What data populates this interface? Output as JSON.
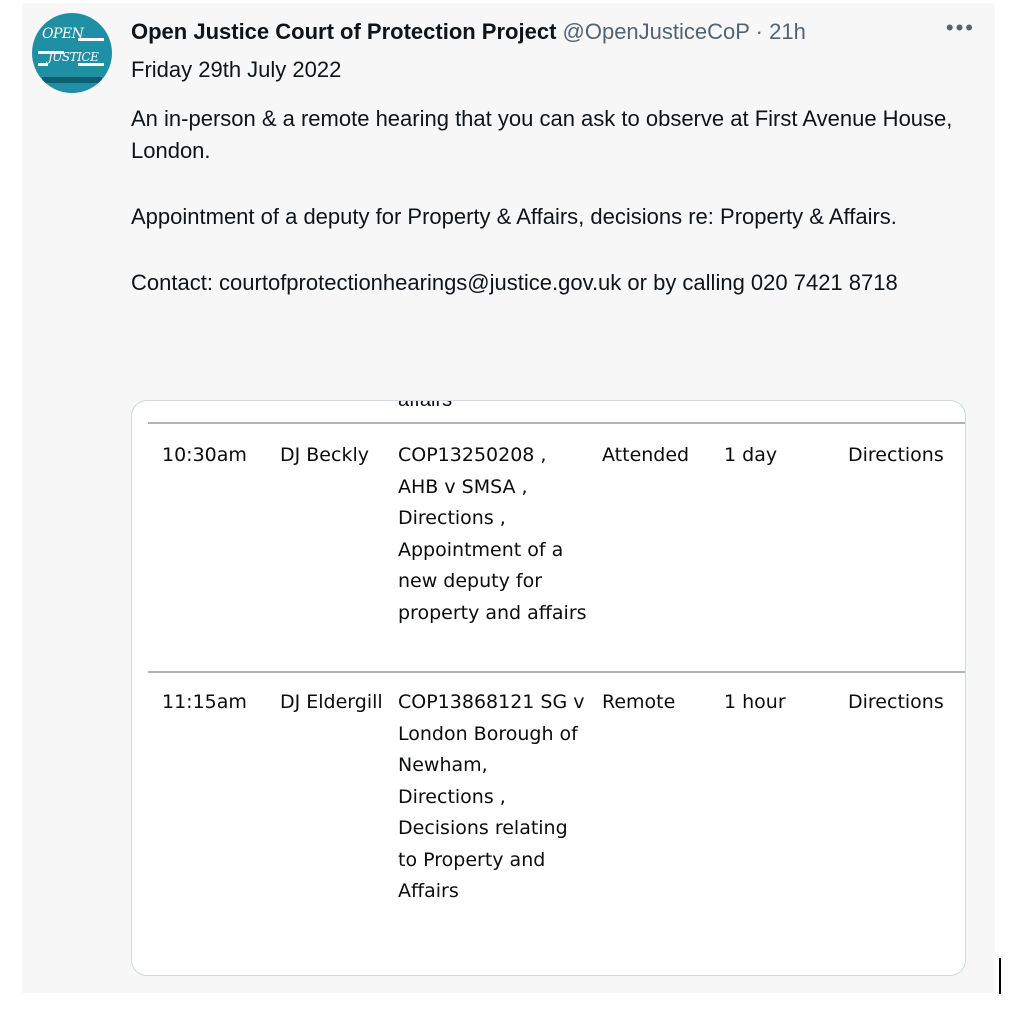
{
  "tweet": {
    "display_name": "Open Justice Court of Protection Project",
    "handle": "@OpenJusticeCoP",
    "separator": "·",
    "time": "21h",
    "more_label": "•••",
    "avatar": {
      "logo_line1": "OPEN",
      "logo_line2": "JUSTICE",
      "background_color": "#1f8fa3"
    },
    "paragraphs": [
      "Friday 29th July 2022",
      "An in-person & a remote hearing that you can ask to observe at First Avenue House, London.",
      "Appointment of a deputy for Property & Affairs, decisions re: Property & Affairs.",
      "Contact: courtofprotectionhearings@justice.gov.uk or by calling 020 7421 8718"
    ]
  },
  "hearing_table": {
    "cut_off_text": "affairs",
    "rows": [
      {
        "time": "10:30am",
        "judge": "DJ Beckly",
        "case": "COP13250208 , AHB v SMSA , Directions , Appointment of a new deputy for property and affairs",
        "type": "Attended",
        "duration": "1 day",
        "hearing": "Directions"
      },
      {
        "time": "11:15am",
        "judge": "DJ Eldergill",
        "case": "COP13868121 SG v London Borough of Newham, Directions , Decisions relating to Property and Affairs",
        "type": "Remote",
        "duration": "1 hour",
        "hearing": "Directions"
      }
    ]
  }
}
